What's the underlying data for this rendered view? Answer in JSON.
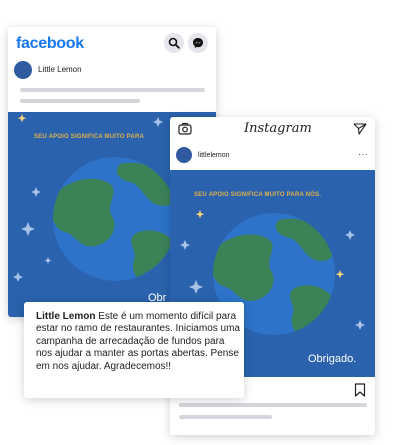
{
  "facebook": {
    "logo": "facebook",
    "page_name": "Little Lemon",
    "post": {
      "headline": "SEU APOIO SIGNIFICA MUITO PARA",
      "thanks": "Obr"
    }
  },
  "instagram": {
    "wordmark": "Instagram",
    "username": "littlelemon",
    "more": "···",
    "post": {
      "headline": "SEU APOIO SIGNIFICA MUITO PARA NÓS.",
      "thanks": "Obrigado."
    }
  },
  "caption": {
    "author": "Little Lemon",
    "text": "Este é um momento difícil para estar no ramo de restaurantes. Iniciamos uma campanha de arrecadação de fundos para nos ajudar a manter as portas abertas. Pense em nos ajudar. Agradecemos!!"
  },
  "colors": {
    "facebook_blue": "#1877f2",
    "post_background": "#2a62ad",
    "headline_gold": "#e0b24a",
    "ocean": "#2c73c9",
    "land": "#3c8257"
  }
}
